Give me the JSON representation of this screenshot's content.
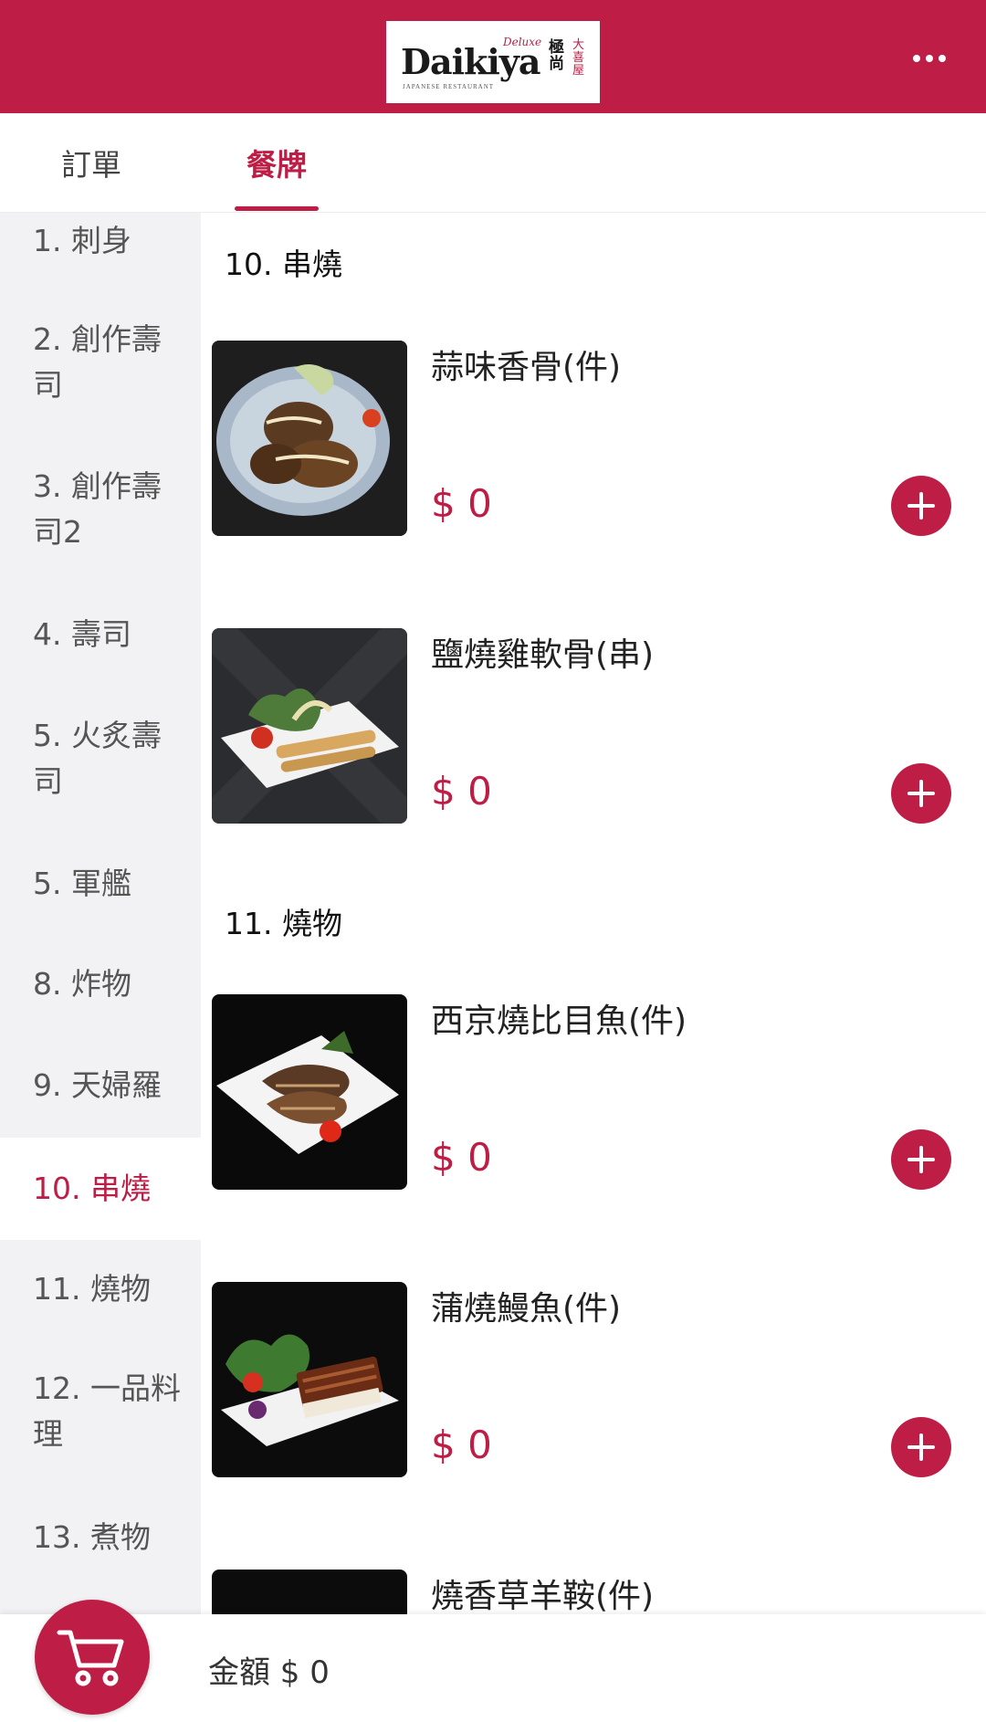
{
  "header": {
    "logo": {
      "name": "Daikiya",
      "script": "Deluxe",
      "subtitle": "JAPANESE RESTAURANT",
      "kanji_a": "極尚",
      "kanji_b": "大喜屋"
    },
    "menu_icon": "more-dots-icon",
    "background": "#be1d45"
  },
  "tabs": [
    {
      "label": "訂單",
      "active": false
    },
    {
      "label": "餐牌",
      "active": true
    }
  ],
  "sidebar": {
    "items": [
      {
        "label": "1. 刺身"
      },
      {
        "label": "2. 創作壽司"
      },
      {
        "label": "3. 創作壽司2"
      },
      {
        "label": "4. 壽司"
      },
      {
        "label": "5. 火炙壽司"
      },
      {
        "label": "5. 軍艦"
      },
      {
        "label": "8. 炸物"
      },
      {
        "label": "9. 天婦羅"
      },
      {
        "label": "10. 串燒",
        "active": true
      },
      {
        "label": "11. 燒物"
      },
      {
        "label": "12. 一品料理"
      },
      {
        "label": "13. 煮物"
      }
    ]
  },
  "sections": [
    {
      "title": "10. 串燒",
      "items": [
        {
          "name": "蒜味香骨(件)",
          "price": "$ 0",
          "image": "garlic-ribs-dish"
        },
        {
          "name": "鹽燒雞軟骨(串)",
          "price": "$ 0",
          "image": "chicken-cartilage-skewers"
        }
      ]
    },
    {
      "title": "11. 燒物",
      "items": [
        {
          "name": "西京燒比目魚(件)",
          "price": "$ 0",
          "image": "saikyo-flounder"
        },
        {
          "name": "蒲燒鰻魚(件)",
          "price": "$ 0",
          "image": "kabayaki-eel"
        },
        {
          "name": "燒香草羊鞍(件)",
          "price": "",
          "image": "herb-lamb-rack"
        }
      ]
    }
  ],
  "bottom_bar": {
    "cart_icon": "shopping-cart-icon",
    "total_label": "金額 $ 0"
  },
  "colors": {
    "accent": "#be1d45",
    "sidebar_bg": "#f2f2f4"
  }
}
